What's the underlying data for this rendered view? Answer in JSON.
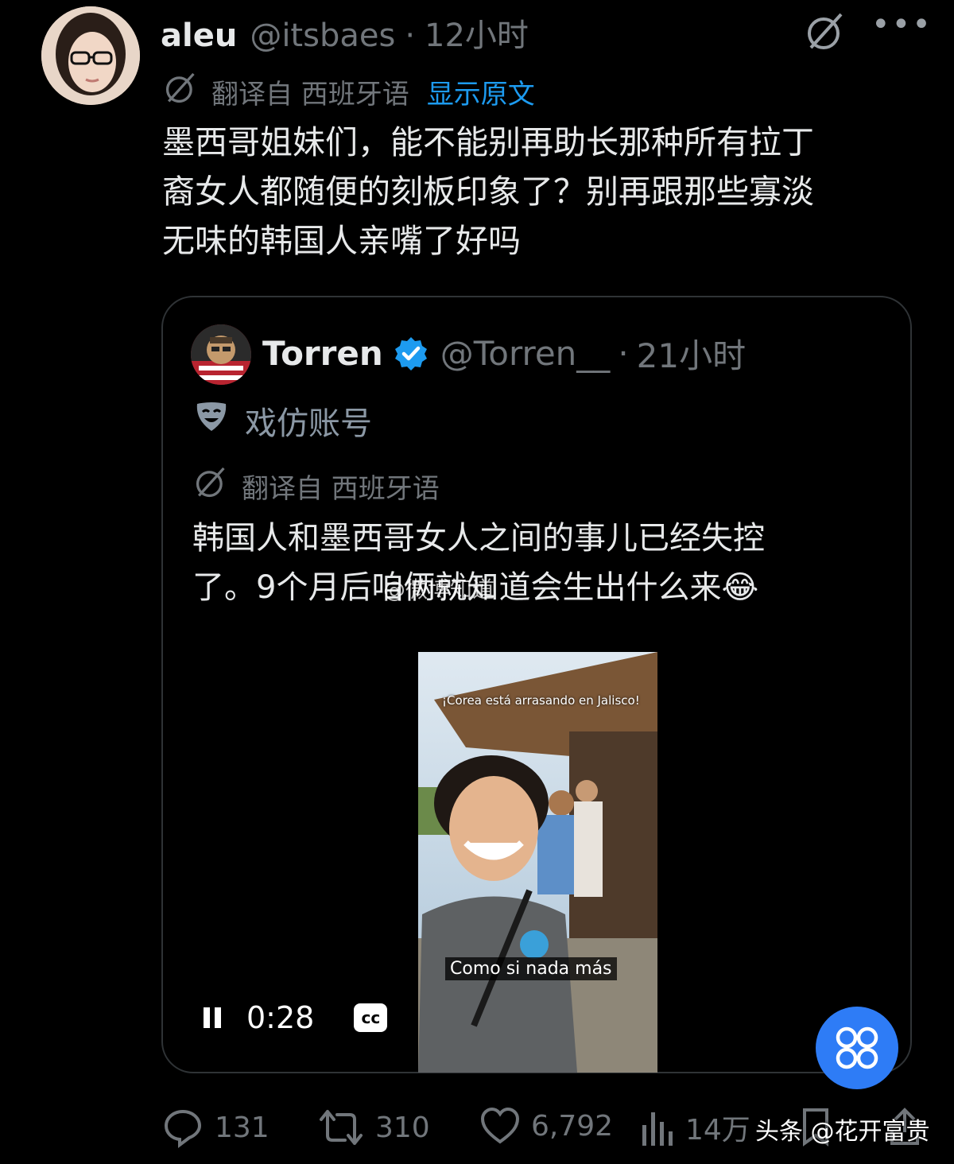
{
  "tweet": {
    "author_name": "aleu",
    "author_handle": "@itsbaes",
    "separator": "·",
    "time_ago": "12小时",
    "translated_from": "翻译自 西班牙语",
    "show_original": "显示原文",
    "text_lines": [
      "墨西哥姐妹们，能不能别再助长那种所有拉丁",
      "裔女人都随便的刻板印象了？别再跟那些寡淡",
      "无味的韩国人亲嘴了好吗"
    ]
  },
  "quoted": {
    "author_name": "Torren",
    "author_handle": "@Torren__",
    "separator": "·",
    "time_ago": "21小时",
    "parody_label": "戏仿账号",
    "translated_from": "翻译自 西班牙语",
    "text_lines": [
      "韩国人和墨西哥女人之间的事儿已经失控",
      "了。9个月后咱俩就知道会生出什么来😂"
    ],
    "video": {
      "overlay_caption": "¡Corea está arrasando en Jalisco!",
      "subtitle": "Como si nada más",
      "time": "0:28",
      "cc_label": "cc"
    }
  },
  "actions": {
    "replies": "131",
    "retweets": "310",
    "likes": "6,792",
    "views": "14万"
  },
  "watermark": {
    "bottom": "头条 @花开富贵",
    "center": "@微博知道"
  },
  "colors": {
    "background": "#000000",
    "link": "#1d9bf0",
    "verified": "#1d9bf0",
    "fab": "#2e7cf6",
    "muted": "#71767b"
  },
  "icons": [
    "grok-icon",
    "more-icon",
    "translate-icon",
    "verified-badge-icon",
    "parody-mask-icon",
    "pause-icon",
    "cc-icon",
    "reply-icon",
    "retweet-icon",
    "like-icon",
    "views-icon",
    "bookmark-icon",
    "share-icon",
    "fab-grid-icon"
  ]
}
